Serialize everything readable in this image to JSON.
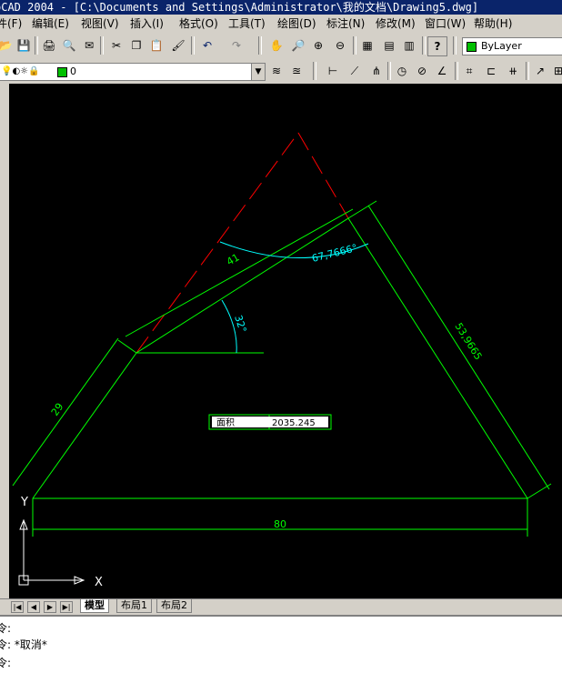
{
  "window": {
    "title": "oCAD 2004 - [C:\\Documents and Settings\\Administrator\\我的文档\\Drawing5.dwg]"
  },
  "menu": [
    "件(F)",
    "编辑(E)",
    "视图(V)",
    "插入(I)",
    "格式(O)",
    "工具(T)",
    "绘图(D)",
    "标注(N)",
    "修改(M)",
    "窗口(W)",
    "帮助(H)"
  ],
  "toolbar": {
    "color_combo": "ByLayer",
    "layer_combo": "0"
  },
  "drawing": {
    "dim_41": "41",
    "dim_angle_67": "67,7666°",
    "dim_angle_32": "32°",
    "dim_53": "53,9665",
    "dim_29": "29",
    "dim_80": "80",
    "area_label": "面积",
    "area_value": "2035.245",
    "ucs_x": "X",
    "ucs_y": "Y",
    "colors": {
      "geometry": "#00ff00",
      "hidden": "#ff0000",
      "dimension": "#00ffff"
    }
  },
  "tabs": {
    "model": "模型",
    "layout1": "布局1",
    "layout2": "布局2"
  },
  "command": {
    "line1": "令:",
    "line2": "令: *取消*",
    "line3": "令:"
  }
}
